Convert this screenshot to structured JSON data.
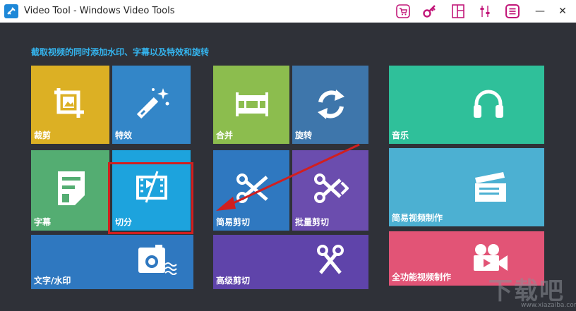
{
  "window": {
    "title": "Video Tool - Windows Video Tools",
    "minimize": "—",
    "restore": "□",
    "close": "✕"
  },
  "toolbar": {
    "cart_icon": "cart-icon",
    "key_icon": "key-icon",
    "layout_icon": "layout-icon",
    "settings_icon": "sliders-icon",
    "menu_icon": "menu-icon",
    "accent": "#c2187a"
  },
  "heading": "截取视频的同时添加水印、字幕以及特效和旋转",
  "tiles": {
    "crop": "裁剪",
    "effects": "特效",
    "merge": "合并",
    "rotate": "旋转",
    "music": "音乐",
    "subtitle": "字幕",
    "split": "切分",
    "simple_cut": "简易剪切",
    "batch_cut": "批量剪切",
    "simple_video": "简易视频制作",
    "text_watermark": "文字/水印",
    "advanced_cut": "高级剪切",
    "full_video": "全功能视频制作"
  },
  "colors": {
    "crop": "#dcb024",
    "effects": "#3386c8",
    "merge": "#8cbd4e",
    "rotate": "#3e76ab",
    "music": "#2fc09a",
    "subtitle": "#54ad72",
    "split": "#1da3dd",
    "simple_cut": "#2f78c0",
    "batch_cut": "#6b4dae",
    "simple_video": "#4cb0d2",
    "text_watermark": "#2f78c0",
    "advanced_cut": "#5f44aa",
    "full_video": "#e25476"
  },
  "watermark": {
    "main": "下载吧",
    "sub": "www.xiazaiba.com"
  }
}
